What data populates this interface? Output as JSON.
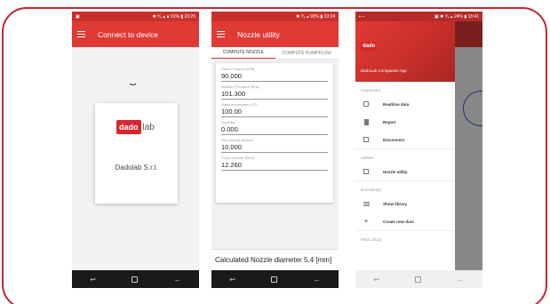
{
  "phone1": {
    "status": {
      "left": "▣",
      "right": "✱ ⁰⁄₀ ▴ ∎ 91% ▮ 10:25"
    },
    "title": "Connect to device",
    "device_card": {
      "logo_red": "dado",
      "logo_grey": "lab",
      "name": "Dadolab S.r.l."
    }
  },
  "phone2": {
    "status": {
      "left": "",
      "right": "✱ ⁰⁄₀ ▴ 92% ▮ 10:24"
    },
    "title": "Nozzle utility",
    "tabs": [
      "COMPUTE NOZZLE",
      "COMPUTE PUMPFLOW"
    ],
    "fields": [
      {
        "label": "Stack Pressure [kPa]",
        "value": "90.000"
      },
      {
        "label": "Ambient Pressure [kPa]",
        "value": "101.300"
      },
      {
        "label": "Stack temperature [°C]",
        "value": "100.00"
      },
      {
        "label": "Humidity",
        "value": "0.000"
      },
      {
        "label": "Gas velocity [m/sec]",
        "value": "10.000"
      },
      {
        "label": "Pump flowrate [l/min]",
        "value": "12.260"
      }
    ],
    "result": "Calculated Nozzle diameter 5,4 [mm]"
  },
  "phone3": {
    "status": {
      "left": "▪ ─",
      "right": "▣ ✱ ⁰⁄₀ ▴ 24% ▮ 18:41"
    },
    "drawer": {
      "logo": "dado",
      "app_title": "DadoLab Companion App",
      "sections": [
        {
          "title": "Connected",
          "items": [
            {
              "icon": "realtime-icon",
              "label": "Realtime data"
            },
            {
              "icon": "report-icon",
              "label": "Report"
            },
            {
              "icon": "disconnect-icon",
              "label": "Disconnect"
            }
          ]
        },
        {
          "title": "Utilities",
          "items": [
            {
              "icon": "nozzle-icon",
              "label": "Nozzle utility"
            }
          ]
        },
        {
          "title": "Duct library",
          "items": [
            {
              "icon": "list-icon",
              "label": "Show library"
            },
            {
              "icon": "plus-icon",
              "label": "Create new duct"
            }
          ]
        },
        {
          "title": "Pitot Library",
          "items": []
        }
      ]
    }
  },
  "navbar": {
    "back": "↩",
    "home": "",
    "recent": "←"
  },
  "colors": {
    "accent": "#e03a35",
    "status": "#c9302c",
    "frame": "#c0272d"
  }
}
